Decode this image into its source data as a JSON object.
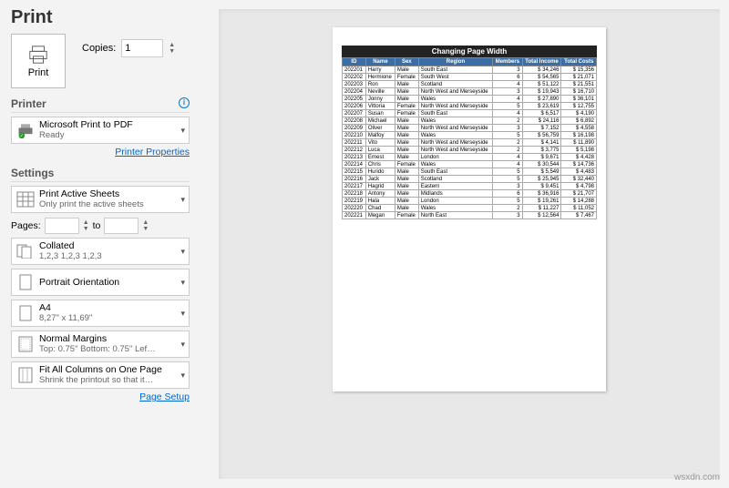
{
  "title": "Print",
  "print_button": "Print",
  "copies": {
    "label": "Copies:",
    "value": "1"
  },
  "printer_heading": "Printer",
  "printer": {
    "name": "Microsoft Print to PDF",
    "status": "Ready"
  },
  "printer_properties": "Printer Properties",
  "settings_heading": "Settings",
  "scope": {
    "main": "Print Active Sheets",
    "sub": "Only print the active sheets"
  },
  "pages": {
    "label": "Pages:",
    "to": "to",
    "from": "",
    "until": ""
  },
  "collated": {
    "main": "Collated",
    "sub": "1,2,3   1,2,3   1,2,3"
  },
  "orientation": {
    "main": "Portrait Orientation"
  },
  "paper": {
    "main": "A4",
    "sub": "8,27\" x 11,69\""
  },
  "margins": {
    "main": "Normal Margins",
    "sub": "Top: 0.75\" Bottom: 0.75\" Left:…"
  },
  "scaling": {
    "main": "Fit All Columns on One Page",
    "sub": "Shrink the printout so that it…"
  },
  "page_setup": "Page Setup",
  "preview": {
    "title": "Changing Page Width",
    "headers": [
      "ID",
      "Name",
      "Sex",
      "Region",
      "Members",
      "Total Income",
      "Total Costs"
    ],
    "rows": [
      [
        "202201",
        "Harry",
        "Male",
        "South East",
        "3",
        "$   34,246",
        "$   15,356"
      ],
      [
        "202202",
        "Hermione",
        "Female",
        "South West",
        "6",
        "$   54,565",
        "$   21,071"
      ],
      [
        "202203",
        "Ron",
        "Male",
        "Scotland",
        "4",
        "$   51,122",
        "$   21,551"
      ],
      [
        "202204",
        "Neville",
        "Male",
        "North West and Merseyside",
        "3",
        "$   19,943",
        "$   16,710"
      ],
      [
        "202205",
        "Jonny",
        "Male",
        "Wales",
        "4",
        "$   27,890",
        "$   36,101"
      ],
      [
        "202206",
        "Vittoria",
        "Female",
        "North West and Merseyside",
        "5",
        "$   23,619",
        "$   12,755"
      ],
      [
        "202207",
        "Susan",
        "Female",
        "South East",
        "4",
        "$    6,517",
        "$    4,190"
      ],
      [
        "202208",
        "Michael",
        "Male",
        "Wales",
        "2",
        "$   24,116",
        "$    6,892"
      ],
      [
        "202209",
        "Oliver",
        "Male",
        "North West and Merseyside",
        "3",
        "$    7,152",
        "$    4,558"
      ],
      [
        "202210",
        "Malfoy",
        "Male",
        "Wales",
        "5",
        "$   56,759",
        "$   16,198"
      ],
      [
        "202211",
        "Vito",
        "Male",
        "North West and Merseyside",
        "2",
        "$    4,141",
        "$   11,890"
      ],
      [
        "202212",
        "Luca",
        "Male",
        "North West and Merseyside",
        "2",
        "$    3,775",
        "$    5,198"
      ],
      [
        "202213",
        "Ernest",
        "Male",
        "London",
        "4",
        "$    9,671",
        "$    4,428"
      ],
      [
        "202214",
        "Chris",
        "Female",
        "Wales",
        "4",
        "$   30,544",
        "$   14,736"
      ],
      [
        "202215",
        "Hurido",
        "Male",
        "South East",
        "5",
        "$    5,549",
        "$    4,483"
      ],
      [
        "202216",
        "Jack",
        "Male",
        "Scotland",
        "5",
        "$   25,945",
        "$   32,440"
      ],
      [
        "202217",
        "Hagrid",
        "Male",
        "Eastern",
        "3",
        "$    9,451",
        "$    4,798"
      ],
      [
        "202218",
        "Antony",
        "Male",
        "Midlands",
        "6",
        "$   36,916",
        "$   21,707"
      ],
      [
        "202219",
        "Hala",
        "Male",
        "London",
        "5",
        "$   19,261",
        "$   14,288"
      ],
      [
        "202220",
        "Chad",
        "Male",
        "Wales",
        "2",
        "$   11,227",
        "$   11,052"
      ],
      [
        "202221",
        "Megan",
        "Female",
        "North East",
        "3",
        "$   12,564",
        "$    7,467"
      ]
    ]
  },
  "watermark": "wsxdn.com"
}
